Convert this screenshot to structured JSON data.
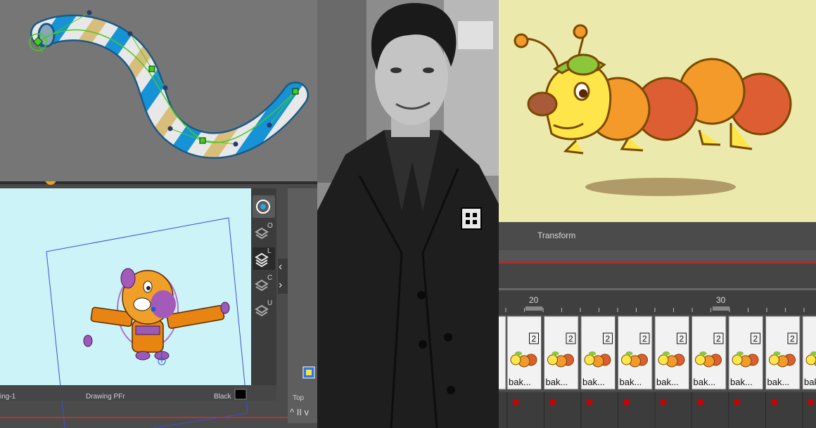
{
  "camera_view": {
    "status_left": "ing-1",
    "status_center": "Drawing PFr",
    "status_color_name": "Black",
    "status_color": "#000000",
    "bottom_tab": "Top",
    "layer_icons": [
      "eye-icon",
      "layer-o-icon",
      "layer-l-icon",
      "layer-c-icon",
      "layer-u-icon"
    ],
    "layer_letters": [
      "O",
      "L",
      "C",
      "U"
    ]
  },
  "timeline": {
    "header_label": "Transform",
    "frame_markers": [
      "20",
      "30"
    ],
    "cell_number": "2",
    "cell_label": "bak..."
  },
  "colors": {
    "canvas_bg": "#ccf4f8",
    "stroke_blue": "#1593d6",
    "stroke_tan": "#d9bd7a",
    "spline_green": "#44cc22",
    "keyframe_red": "#cc0000",
    "caterpillar_orange": "#f39a2a",
    "caterpillar_red": "#dd5e32",
    "caterpillar_yellow": "#fde54a"
  }
}
